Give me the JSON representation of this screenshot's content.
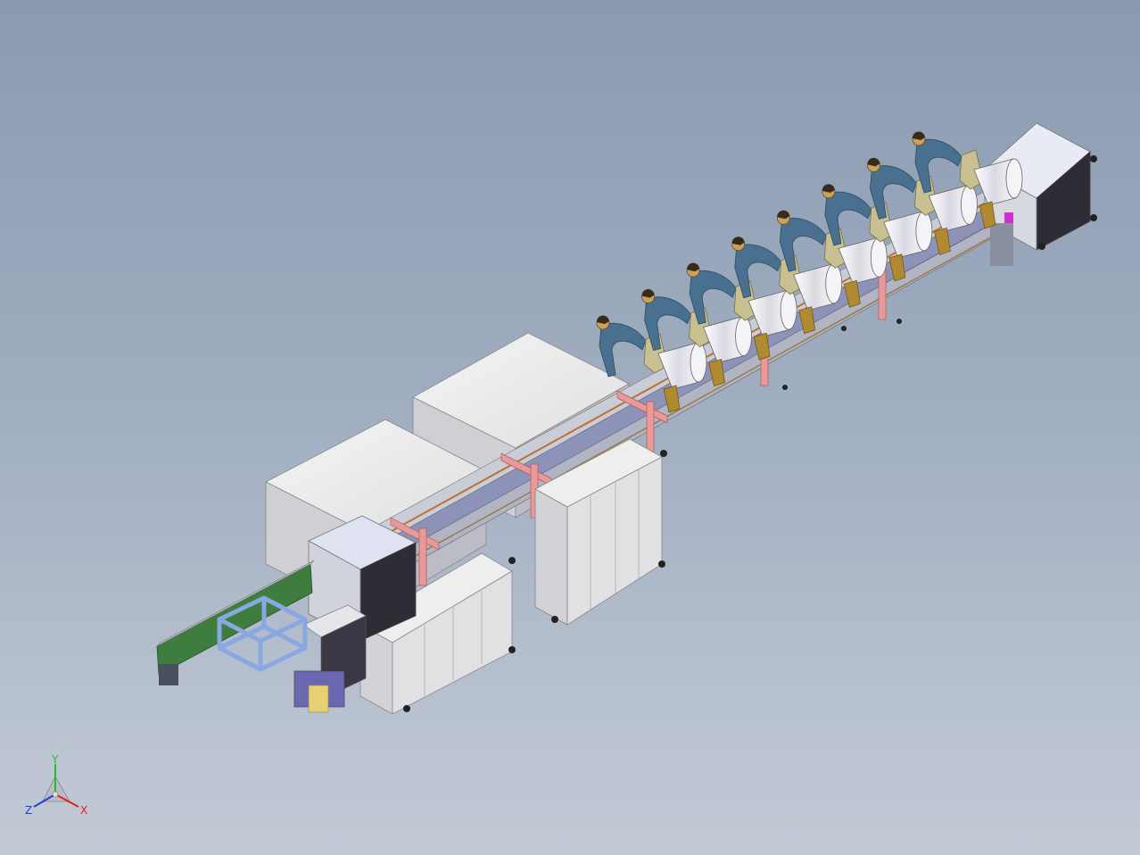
{
  "triad": {
    "x_label": "X",
    "y_label": "Y",
    "z_label": "Z",
    "colors": {
      "x": "#e02020",
      "y": "#20c020",
      "z": "#2040d0"
    }
  },
  "scene": {
    "operator_count": 8,
    "colors": {
      "cabinet": "#e4e4e4",
      "rail": "#b8bdcc",
      "bracket": "#e89a9a",
      "conveyor": "#3a7a3a",
      "frame": "#8aa8e0",
      "operator": "#4a7090",
      "seat": "#c8c090",
      "accent": "#d030d0"
    }
  }
}
